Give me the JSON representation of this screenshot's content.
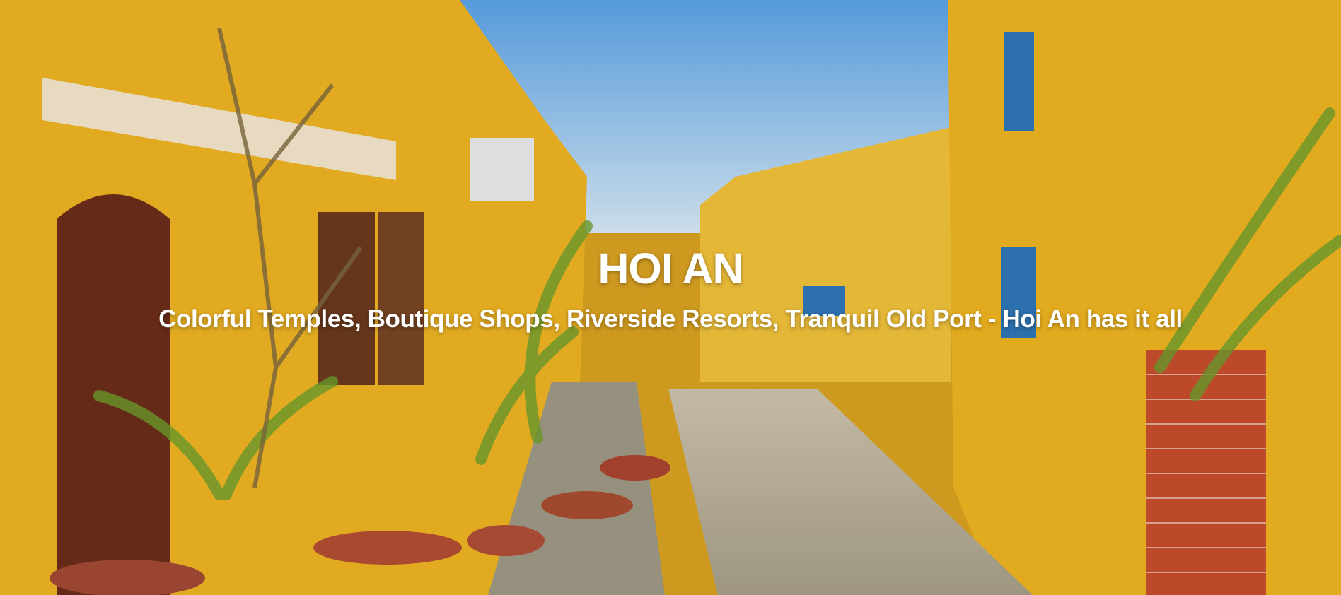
{
  "hero": {
    "title": "HOI AN",
    "subtitle": "Colorful Temples, Boutique Shops, Riverside Resorts, Tranquil Old Port - Hoi An has it all"
  },
  "colors": {
    "wall_yellow": "#f2b62a",
    "sky_blue": "#7cb7ef",
    "brick_red": "#c74e2d",
    "shutter_blue": "#2f78b9",
    "door_brown": "#6b3d1c",
    "road_gray": "#bdb5a5",
    "palm_green": "#5f8d2d"
  }
}
